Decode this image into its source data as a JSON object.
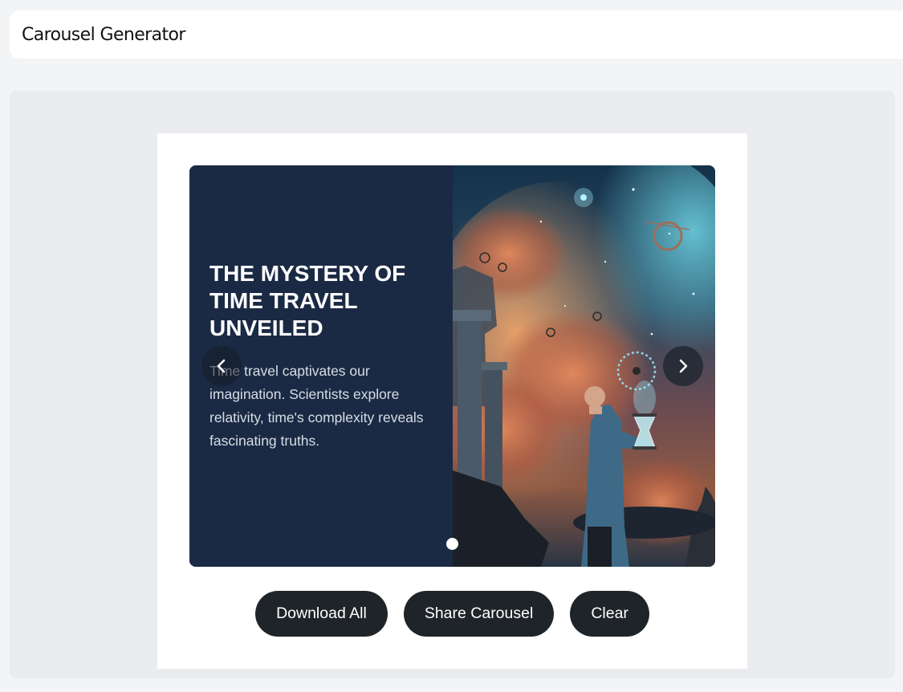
{
  "header": {
    "title": "Carousel Generator"
  },
  "carousel": {
    "slides": [
      {
        "title": "The Mystery of Time Travel Unveiled",
        "body": "Time travel captivates our imagination. Scientists explore relativity, time's complexity reveals fascinating truths.",
        "image": "scientist-hourglass-cosmic-nebula"
      }
    ],
    "active_index": 0,
    "prev_icon": "chevron-left-icon",
    "next_icon": "chevron-right-icon"
  },
  "actions": {
    "download_label": "Download All",
    "share_label": "Share Carousel",
    "clear_label": "Clear"
  },
  "colors": {
    "page_bg": "#f3f4f6",
    "slide_panel": "#1b2a44",
    "button_bg": "#1f2429",
    "button_text": "#ffffff"
  }
}
